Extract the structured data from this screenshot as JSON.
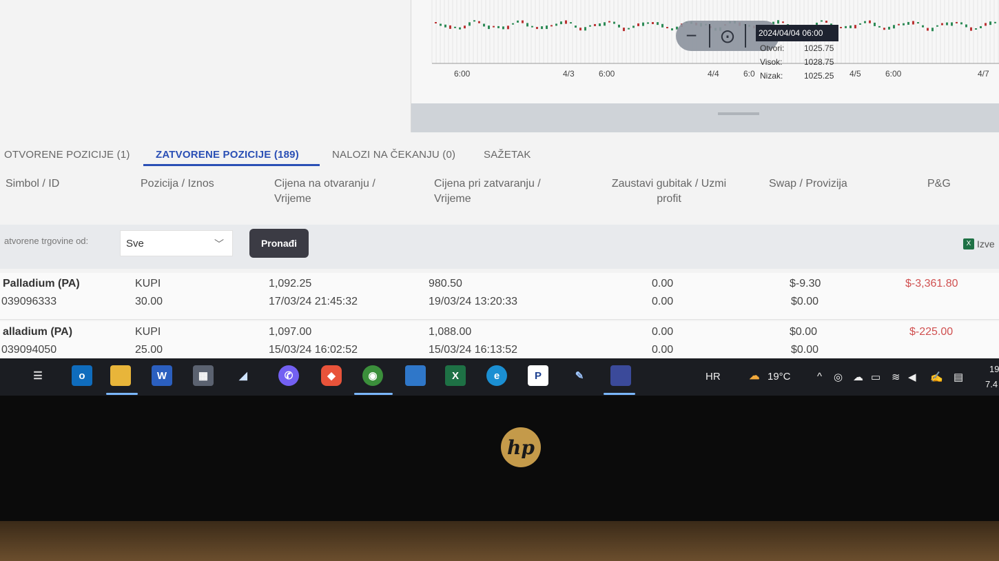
{
  "chart": {
    "x_ticks": [
      "6:00",
      "4/3",
      "6:00",
      "4/4",
      "6:0",
      "4/5",
      "6:00",
      "4/7"
    ],
    "zoom": {
      "minus": "−",
      "reset": "⊙",
      "plus": "+"
    },
    "tooltip": {
      "datetime": "2024/04/04 06:00",
      "rows": [
        {
          "label": "Otvori:",
          "value": "1025.75"
        },
        {
          "label": "Visok:",
          "value": "1028.75"
        },
        {
          "label": "Nizak:",
          "value": "1025.25"
        }
      ]
    }
  },
  "tabs": [
    {
      "label": "OTVORENE POZICIJE (1)"
    },
    {
      "label": "ZATVORENE POZICIJE (189)"
    },
    {
      "label": "NALOZI NA ČEKANJU (0)"
    },
    {
      "label": "SAŽETAK"
    }
  ],
  "columns": [
    {
      "line1": "Simbol / ID",
      "line2": ""
    },
    {
      "line1": "Pozicija / Iznos",
      "line2": ""
    },
    {
      "line1": "Cijena na otvaranju /",
      "line2": "Vrijeme"
    },
    {
      "line1": "Cijena pri zatvaranju /",
      "line2": "Vrijeme"
    },
    {
      "line1": "Zaustavi gubitak / Uzmi",
      "line2": "profit"
    },
    {
      "line1": "Swap / Provizija",
      "line2": ""
    },
    {
      "line1": "P&G",
      "line2": ""
    }
  ],
  "filter": {
    "label": "atvorene trgovine od:",
    "select_value": "Sve",
    "find_label": "Pronađi",
    "export_label": "Izve"
  },
  "rows": [
    {
      "symbol": "Palladium (PA)",
      "id": "039096333",
      "side": "KUPI",
      "amount": "30.00",
      "open_price": "1,092.25",
      "open_time": "17/03/24 21:45:32",
      "close_price": "980.50",
      "close_time": "19/03/24 13:20:33",
      "stop_loss": "0.00",
      "take_profit": "0.00",
      "swap": "$-9.30",
      "commission": "$0.00",
      "pnl": "$-3,361.80"
    },
    {
      "symbol": "alladium (PA)",
      "id": "039094050",
      "side": "KUPI",
      "amount": "25.00",
      "open_price": "1,097.00",
      "open_time": "15/03/24 16:02:52",
      "close_price": "1,088.00",
      "close_time": "15/03/24 16:13:52",
      "stop_loss": "0.00",
      "take_profit": "0.00",
      "swap": "$0.00",
      "commission": "$0.00",
      "pnl": "$-225.00"
    }
  ],
  "taskbar": {
    "language": "HR",
    "temperature": "19°C",
    "clock_time": "19",
    "clock_date": "7.4",
    "icons": [
      "task-view-icon",
      "outlook-icon",
      "file-explorer-icon",
      "word-icon",
      "calculator-icon",
      "scanner-icon",
      "viber-icon",
      "brave-icon",
      "chrome-icon",
      "app-icon",
      "excel-icon",
      "edge-icon",
      "paypal-icon",
      "paint-icon",
      "trading-app-icon"
    ]
  },
  "brand": {
    "logo_text": "hp"
  },
  "colors": {
    "accent": "#2a4fb5",
    "loss": "#d05050",
    "button": "#3b3b44"
  }
}
